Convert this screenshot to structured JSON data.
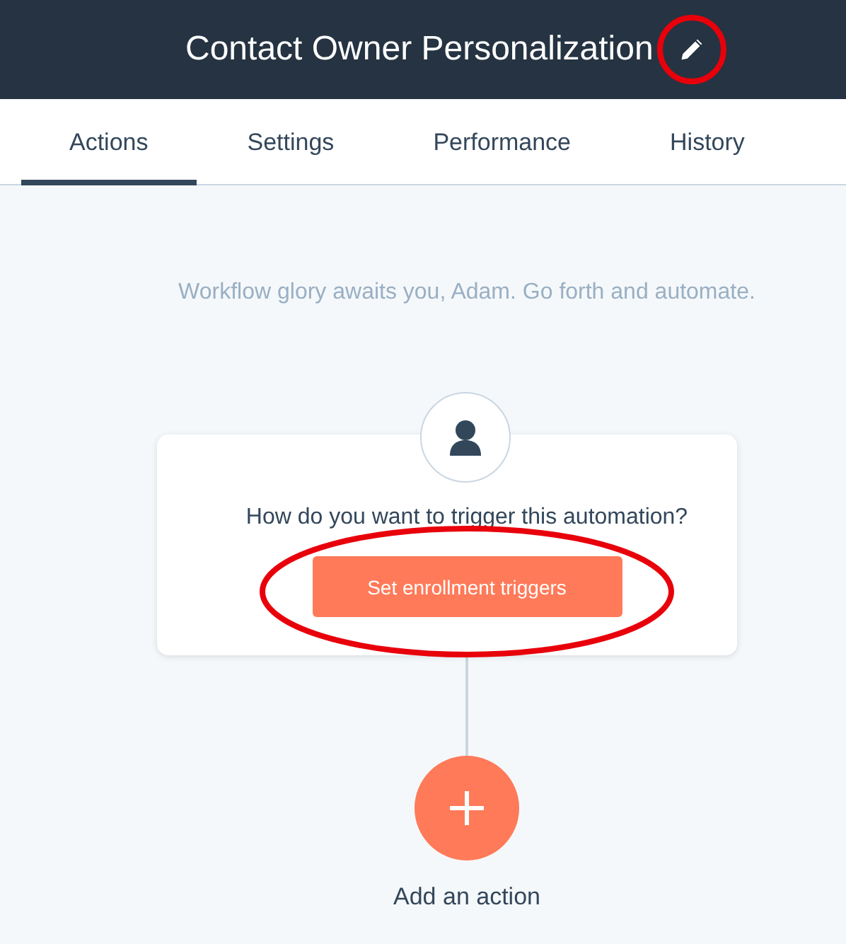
{
  "header": {
    "title": "Contact Owner Personalization",
    "edit_icon_highlighted": true
  },
  "tabs": [
    {
      "label": "Actions",
      "selected": true
    },
    {
      "label": "Settings",
      "selected": false
    },
    {
      "label": "Performance",
      "selected": false
    },
    {
      "label": "History",
      "selected": false
    }
  ],
  "tagline": "Workflow glory awaits you, Adam. Go forth and automate.",
  "trigger_card": {
    "question": "How do you want to trigger this automation?",
    "button": "Set enrollment triggers",
    "button_highlighted": true
  },
  "add_action": {
    "label": "Add an action"
  }
}
